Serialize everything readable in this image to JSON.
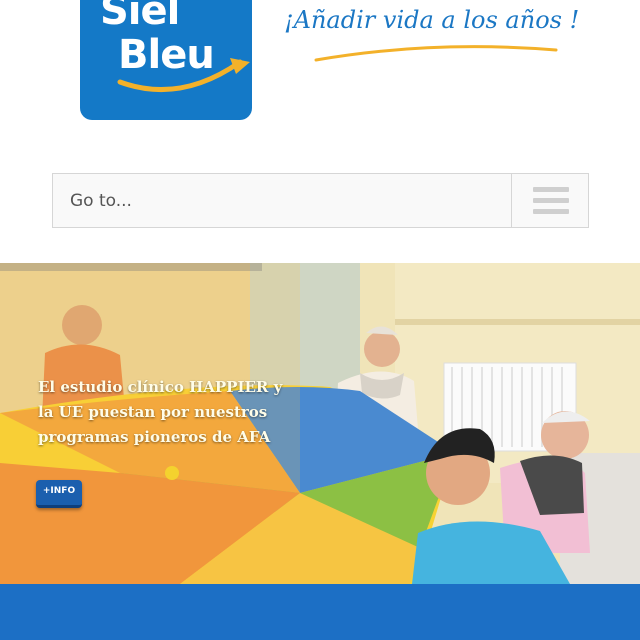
{
  "brand": {
    "logo_line1": "Siel",
    "logo_line2": "Bleu",
    "tagline": "¡Añadir vida a los años !",
    "logo_color": "#1479c7",
    "swoosh_color": "#f3b12a"
  },
  "nav": {
    "goto_label": "Go to...",
    "menu_icon": "hamburger-menu-icon"
  },
  "hero": {
    "caption": "El estudio clínico HAPPIER y la UE puestan por nuestros programas pioneros de AFA",
    "button_label": "+INFO",
    "button_color": "#1b5fae"
  },
  "footer": {
    "bar_color": "#1c6fc5"
  }
}
